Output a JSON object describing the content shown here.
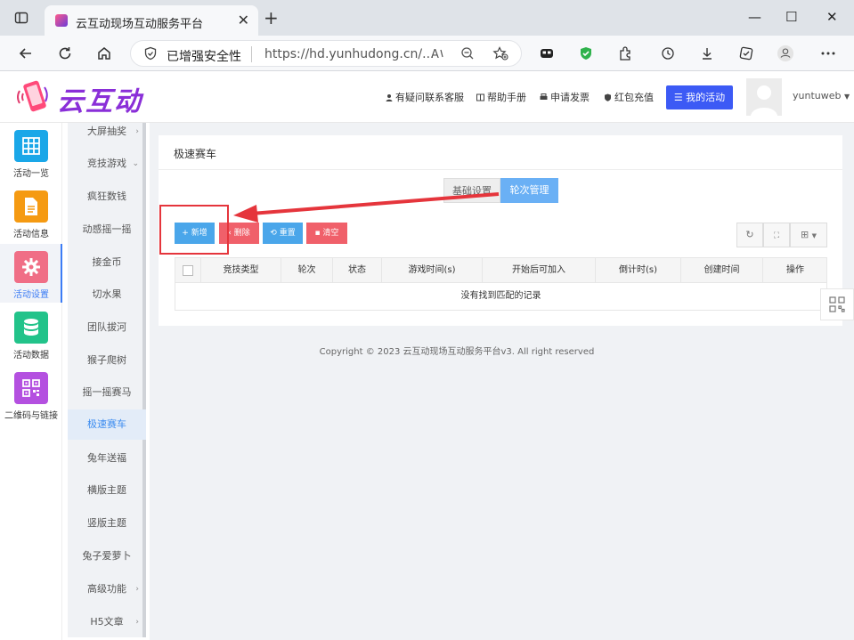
{
  "browser": {
    "tab_title": "云互动现场互动服务平台",
    "security_label": "已增强安全性",
    "url": "https://hd.yunhudong.cn/..."
  },
  "header": {
    "logo_text": "云互动",
    "links": [
      "有疑问联系客服",
      "帮助手册",
      "申请发票",
      "红包充值"
    ],
    "my_activity": "我的活动",
    "username": "yuntuweb"
  },
  "iconbar": [
    {
      "label": "活动一览",
      "icon": "grid-icon",
      "color": "#1aa7e8"
    },
    {
      "label": "活动信息",
      "icon": "document-icon",
      "color": "#f59a12"
    },
    {
      "label": "活动设置",
      "icon": "gear-icon",
      "color": "#f06e86",
      "active": true
    },
    {
      "label": "活动数据",
      "icon": "database-icon",
      "color": "#22c38a"
    },
    {
      "label": "二维码与链接",
      "icon": "qrcode-icon",
      "color": "#b450e0"
    }
  ],
  "submenu": {
    "items": [
      "大屏抽奖",
      "竞技游戏",
      "疯狂数钱",
      "动感摇一摇",
      "接金币",
      "切水果",
      "团队拔河",
      "猴子爬树",
      "摇一摇赛马",
      "极速赛车",
      "兔年送福",
      "横版主题",
      "竖版主题",
      "兔子爱萝卜",
      "高级功能",
      "H5文章"
    ],
    "active": "极速赛车"
  },
  "card": {
    "title": "极速赛车",
    "tabs": [
      "基础设置",
      "轮次管理"
    ],
    "active_tab": "轮次管理",
    "buttons": {
      "add": "+ 新增",
      "delete": "删除",
      "reset": "重置",
      "clear": "清空"
    },
    "columns": [
      "竞技类型",
      "轮次",
      "状态",
      "游戏时间(s)",
      "开始后可加入",
      "倒计时(s)",
      "创建时间",
      "操作"
    ],
    "empty_text": "没有找到匹配的记录"
  },
  "footer": "Copyright © 2023 云互动现场互动服务平台v3. All right reserved",
  "colors": {
    "primary": "#3c5af5",
    "tab_active": "#6ab0f5",
    "add": "#4aa6ea",
    "danger": "#f0606a",
    "annotation": "#e5353c"
  }
}
